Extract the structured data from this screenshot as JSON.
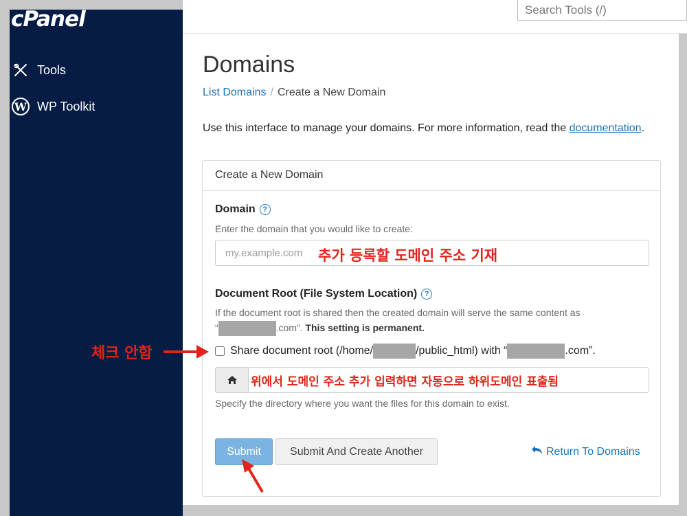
{
  "sidebar": {
    "logo": "cPanel",
    "items": [
      {
        "label": "Tools",
        "icon": "tools-icon"
      },
      {
        "label": "WP Toolkit",
        "icon": "wordpress-icon"
      }
    ]
  },
  "header": {
    "search_placeholder": "Search Tools (/)"
  },
  "page": {
    "title": "Domains",
    "breadcrumb": {
      "link": "List Domains",
      "separator": "/",
      "current": "Create a New Domain"
    },
    "intro_text": "Use this interface to manage your domains. For more information, read the",
    "intro_link": "documentation",
    "intro_end": "."
  },
  "panel": {
    "heading": "Create a New Domain",
    "domain": {
      "label": "Domain",
      "hint": "Enter the domain that you would like to create:",
      "placeholder": "my.example.com",
      "annotation": "추가 등록할 도메인 주소 기재"
    },
    "docroot": {
      "label": "Document Root (File System Location)",
      "hint_line1": "If the document root is shared then the created domain will serve the same content as",
      "hint_line2_prefix": "“",
      "hint_line2_suffix": ".com”.",
      "hint_bold": "This setting is permanent.",
      "share_prefix": "Share document root (/home/",
      "share_mid": "/public_html) with “",
      "share_suffix": ".com”.",
      "dir_annotation": "위에서 도메인 주소 추가 입력하면 자동으로 하위도메인 표출됨",
      "dir_hint": "Specify the directory where you want the files for this domain to exist."
    },
    "buttons": {
      "submit": "Submit",
      "submit_another": "Submit And Create Another",
      "return": "Return To Domains"
    }
  },
  "annotations": {
    "checkbox_note": "체크 안함",
    "color": "#e2231a"
  }
}
